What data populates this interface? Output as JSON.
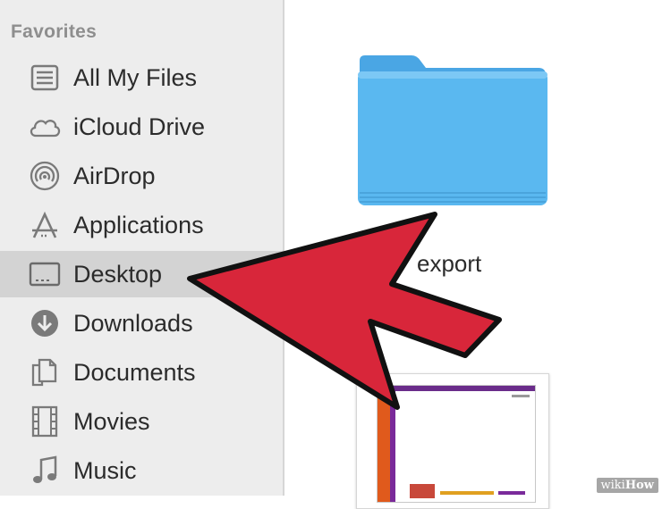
{
  "sidebar": {
    "section_title": "Favorites",
    "items": [
      {
        "label": "All My Files",
        "icon": "all-files-icon"
      },
      {
        "label": "iCloud Drive",
        "icon": "cloud-icon"
      },
      {
        "label": "AirDrop",
        "icon": "airdrop-icon"
      },
      {
        "label": "Applications",
        "icon": "applications-icon"
      },
      {
        "label": "Desktop",
        "icon": "desktop-icon",
        "selected": true
      },
      {
        "label": "Downloads",
        "icon": "downloads-icon"
      },
      {
        "label": "Documents",
        "icon": "documents-icon"
      },
      {
        "label": "Movies",
        "icon": "movies-icon"
      },
      {
        "label": "Music",
        "icon": "music-icon"
      }
    ]
  },
  "content": {
    "folder_name": "export",
    "folder_color": "#5ab8f0",
    "arrow_color": "#d8263a"
  },
  "watermark": {
    "prefix": "wiki",
    "suffix": "How"
  }
}
